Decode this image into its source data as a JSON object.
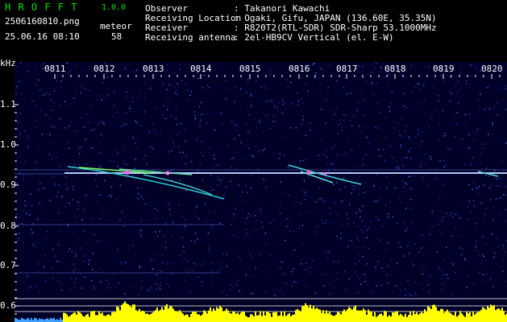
{
  "header": {
    "app_title": "H R O F F T",
    "version": "1.0.0",
    "filename": "2506160810.png",
    "timestamp": "25.06.16 08:10",
    "meteor_label": "meteor",
    "meteor_count": "58",
    "info": [
      {
        "key": "Observer",
        "value": ": Takanori Kawachi"
      },
      {
        "key": "Receiving Location",
        "value": ": Ogaki, Gifu, JAPAN (136.60E, 35.35N)"
      },
      {
        "key": "Receiver",
        "value": ": R820T2(RTL-SDR) SDR-Sharp 53.1000MHz"
      },
      {
        "key": "Receiving antenna",
        "value": ": 2el-HB9CV Vertical (el. E-W)"
      }
    ]
  },
  "axes": {
    "y_unit": "kHz",
    "y_ticks": [
      "1.1",
      "1.0",
      "0.9",
      "0.8",
      "0.7",
      "0.6"
    ],
    "x_ticks": [
      "0811",
      "0812",
      "0813",
      "0814",
      "0815",
      "0816",
      "0817",
      "0818",
      "0819",
      "0820"
    ]
  },
  "colors": {
    "background": "#000000",
    "spectrogram_bg": "#000028",
    "header_green": "#00e000",
    "header_white": "#ffffff",
    "amplitude_bar": "#ffff00",
    "carrier_line": "#b0c8ff"
  }
}
